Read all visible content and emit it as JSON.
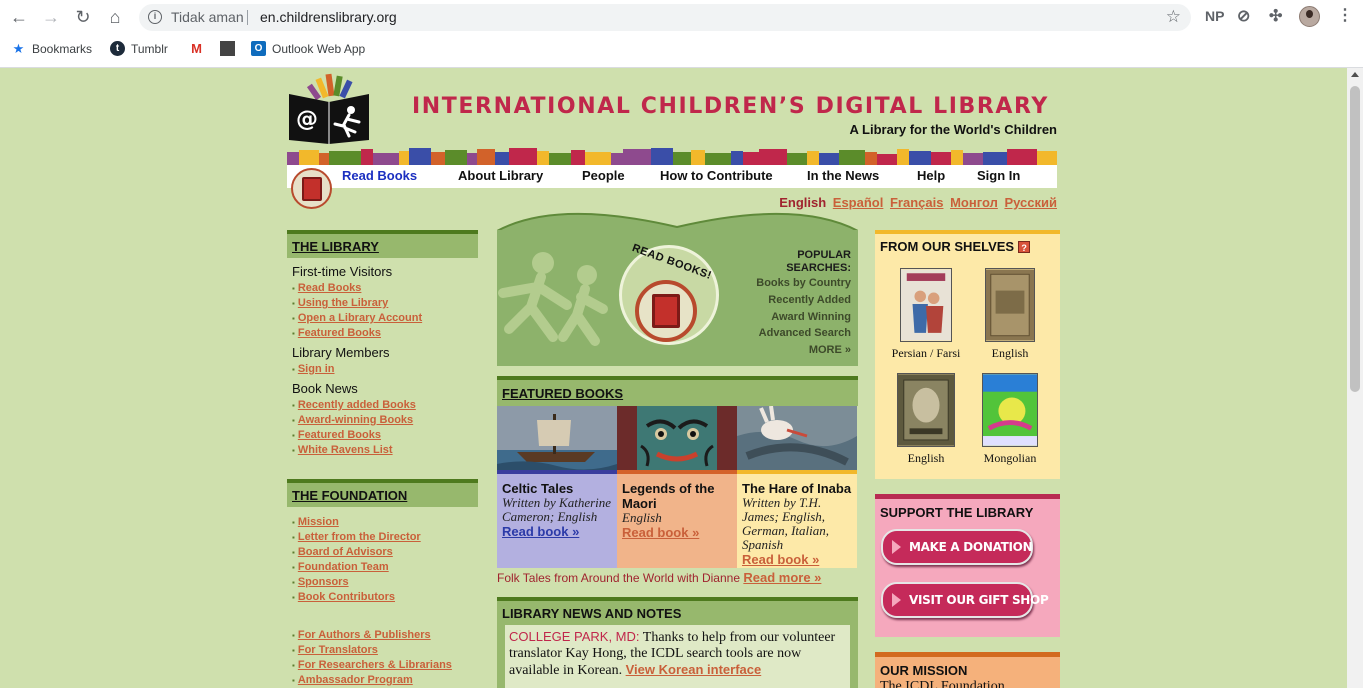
{
  "browser": {
    "security_label": "Tidak aman",
    "url": "en.childrenslibrary.org",
    "profile_initials": "NP",
    "bookmarks": [
      "Bookmarks",
      "Tumblr",
      "Outlook Web App"
    ]
  },
  "header": {
    "title": "INTERNATIONAL CHILDREN’S DIGITAL LIBRARY",
    "subtitle": "A Library for the World's Children"
  },
  "nav": {
    "items": [
      "Read Books",
      "About Library",
      "People",
      "How to Contribute",
      "In the News",
      "Help",
      "Sign In"
    ],
    "active": "Read Books"
  },
  "languages": {
    "current": "English",
    "others": [
      "Español",
      "Français",
      "Монгол",
      "Русский"
    ]
  },
  "library": {
    "heading": "THE LIBRARY",
    "groups": [
      {
        "label": "First-time Visitors",
        "links": [
          "Read Books",
          "Using the Library",
          "Open a Library Account",
          "Featured Books"
        ]
      },
      {
        "label": "Library Members",
        "links": [
          "Sign in"
        ]
      },
      {
        "label": "Book News",
        "links": [
          "Recently added Books",
          "Award-winning Books",
          "Featured Books",
          "White Ravens List"
        ]
      }
    ]
  },
  "foundation": {
    "heading": "THE FOUNDATION",
    "links": [
      "Mission",
      "Letter from the Director",
      "Board of Advisors",
      "Foundation Team",
      "Sponsors",
      "Book Contributors"
    ],
    "extra_links": [
      "For Authors & Publishers",
      "For Translators",
      "For Researchers & Librarians",
      "Ambassador Program"
    ]
  },
  "read_books": {
    "badge_text": "READ BOOKS!",
    "popular_heading": [
      "POPULAR",
      "SEARCHES:"
    ],
    "popular_links": [
      "Books by Country",
      "Recently Added",
      "Award Winning",
      "Advanced Search",
      "MORE »"
    ]
  },
  "featured": {
    "heading": "FEATURED BOOKS",
    "books": [
      {
        "title": "Celtic Tales",
        "meta": "Written by Katherine Cameron; English",
        "link": "Read book »",
        "bg": "#b3b0e0",
        "border": "#3a3d9e",
        "link_color": "#2b3aa8"
      },
      {
        "title": "Legends of the Maori",
        "meta": "English",
        "link": "Read book »",
        "bg": "#f1b48a",
        "border": "#d4622a",
        "link_color": "#c9603a"
      },
      {
        "title": "The Hare of Inaba",
        "meta": "Written by T.H. James; English, German, Italian, Spanish",
        "link": "Read book »",
        "bg": "#fde9a8",
        "border": "#f2b82b",
        "link_color": "#c9603a"
      }
    ],
    "folk_text": "Folk Tales from Around the World with Dianne",
    "folk_link": "Read more »"
  },
  "news": {
    "heading": "LIBRARY NEWS AND NOTES",
    "location": "COLLEGE PARK, MD:",
    "text": "Thanks to help from our volunteer translator Kay Hong, the ICDL search tools are now available in Korean.",
    "link": "View Korean interface"
  },
  "shelves": {
    "heading": "FROM OUR SHELVES",
    "books": [
      {
        "label": "Persian / Farsi",
        "color": "#e8e2d6"
      },
      {
        "label": "English",
        "color": "#8a7650"
      },
      {
        "label": "English",
        "color": "#6f6a48"
      },
      {
        "label": "Mongolian",
        "color": "#52c43a"
      }
    ]
  },
  "support": {
    "heading": "SUPPORT THE LIBRARY",
    "buttons": [
      "MAKE A DONATION",
      "VISIT OUR GIFT SHOP"
    ]
  },
  "mission": {
    "heading": "OUR MISSION",
    "text": "The ICDL Foundation"
  }
}
